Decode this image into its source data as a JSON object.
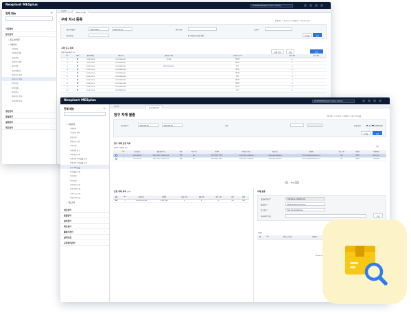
{
  "back": {
    "brand": "Nexplant MESplus",
    "org_select": "IUVCMAN/1Mnsport/ home 1 Factory",
    "sidebar": {
      "title": "전체 메뉴",
      "sections": [
        "기준정보",
        "창고관리"
      ],
      "group": "• 창고관리업무",
      "groups2": [
        "• 자재관리"
      ],
      "items": [
        "구매요청",
        "수입검사 의뢰",
        "자재 전입",
        "자재 입고 접수",
        "자재 이동",
        "부품자재 입고",
        "자재 재고 관리",
        "구매 지시 등록",
        "자재 정보",
        "자재 불출",
        "자재 반납",
        "자재 재고 조회",
        "자재 이력 조회"
      ],
      "sections2": [
        "생산관리",
        "품질관리",
        "설비관리",
        "재고관리"
      ]
    },
    "tabs": [
      "HOME",
      "구매 지시 등록"
    ],
    "title": "구매 지시 등록",
    "breadcrumb": "전체 메뉴 > 창고관리 > 자재관리 > 구매 지시 등록",
    "filters": {
      "order_date_label": "발행 예정일 *",
      "date_from": "2023-09-01",
      "date_to": "2023-10-01",
      "item_label": "품목 번호",
      "supplier_label": "공급처",
      "status_label": "진행 상태",
      "chk_label": "자재 등급 완료 제외",
      "reset": "초기화",
      "search": "조회"
    },
    "list": {
      "title": "구매 요구 목록",
      "count": "전체 25  ▪ 페이지 표시",
      "columns": [
        "No",
        "선택",
        "발행 예정일",
        "품목 번호",
        "구매 요구 번호",
        "구매 요구 수량",
        "발주 수량",
        "입고 처리"
      ],
      "rows": [
        [
          "1",
          "2023-09-08",
          "DLVCNS02001",
          "12346",
          "6",
          "재니퍼"
        ],
        [
          "2",
          "2023-09-09",
          "DLVCNS02002",
          "",
          "6",
          "재니퍼"
        ],
        [
          "3",
          "2023-09-08",
          "DLVCNS02003",
          "PD2303036003",
          "6",
          "김고"
        ],
        [
          "4",
          "2023-09-10",
          "DLVCNS02004",
          "",
          "6",
          "개나리"
        ],
        [
          "5",
          "2023-09-10",
          "DLVCNS02005",
          "",
          "6",
          "아니아"
        ],
        [
          "6",
          "2023-09-11",
          "DLVCNS02006",
          "",
          "6",
          "새다"
        ],
        [
          "7",
          "2023-09-11",
          "DLVCNS02007",
          "",
          "6",
          "재니퍼"
        ],
        [
          "8",
          "2023-09-12",
          "DLVCNS02008",
          "",
          "6",
          "재니퍼"
        ],
        [
          "9",
          "2023-09-13",
          "DLVCNS02009",
          "",
          "6",
          "아니아"
        ],
        [
          "10",
          "2023-09-14",
          "DLVCNS02010",
          "",
          "6",
          "김고"
        ]
      ],
      "buttons": [
        "자재 승인",
        "반납",
        "발주"
      ]
    }
  },
  "front": {
    "brand": "Nexplant MESplus",
    "org_select": "IUVCMAN/1Mnsport/ home 1 Factory",
    "sidebar": {
      "title": "전체 메뉴",
      "group": "• 자재관리",
      "items": [
        "구매요청",
        "수입검사 의뢰",
        "자재 전입",
        "자재 입고 접수",
        "자재 이동",
        "부품자재 입고",
        "자재 재고 관리",
        "부품자재 자재 불출 요청",
        "부품자재 자재 불출 요청",
        "청구 자재 불출",
        "자재 불출 요청",
        "자재 정보",
        "자재 반납",
        "자재 재고 조회",
        "자재 이력 조회",
        "구매 지시 등록",
        "자재 LOT 조회"
      ],
      "group2": "• 재고관리",
      "sections": [
        "생산관리",
        "품질관리",
        "설비관리",
        "재고관리",
        "물류가관리",
        "설비보전",
        "공정관리관리"
      ]
    },
    "tabs": [
      "HOME",
      "청구 자재 불출"
    ],
    "title": "청구 자재 불출",
    "breadcrumb": "전체 메뉴 > 창고관리 > 자재관리 > 청구 자재 불출",
    "filters": {
      "date_label": "요청 일자 *",
      "date_from": "2023-09-01",
      "date_to": "2023-09-01",
      "item_label": "라인",
      "status_label": "요청 상태",
      "status_opts": [
        "요청",
        "진행",
        "완료"
      ],
      "reset": "초기화",
      "search": "조회"
    },
    "req_list": {
      "title": "청구 자재 요청 목록",
      "count": "전체 2  ▪ 페이지 표시",
      "action": "종료",
      "columns": [
        "",
        "No",
        "요청 일자",
        "불출요청 번호",
        "상태",
        "라인 코드",
        "라인명",
        "작업지시 번호",
        "제품 코드",
        "제품명",
        "지시 수량",
        "요청자",
        "자재상태"
      ],
      "rows": [
        [
          "1",
          "2023-09-05",
          "VIRCON11-230905-002",
          "진행",
          "ALL",
          "포장 재고로 이전 1",
          "VIRCON11-2308003",
          "S0000000000S4-6",
          "보조 1000000000S4-6 Ver",
          "100",
          "김연기",
          "PROCESS"
        ],
        [
          "2",
          "2023-09-05",
          "VIRCON11-230905-001",
          "진행",
          "ALL",
          "포장 재고로 이전 1",
          "VIRCON11-2308003",
          "S0000000000S4-6",
          "보조 1000000000S4-6 Ver",
          "100",
          "김연기",
          "CONFIRM"
        ]
      ]
    },
    "pager": {
      "page": "1",
      "size": "Page",
      "per": "10"
    },
    "item_list": {
      "title": "요청 자재 목록",
      "count": "전체 5",
      "columns": [
        "No",
        "자재 코드",
        "자재명",
        "필요 수량",
        "불출수량",
        "요청 수량",
        "단위",
        "상태"
      ],
      "rows": [
        [
          "1",
          "S00000000-1S4",
          "ㅇ 포장 카톤1",
          "4",
          "4",
          "0",
          "EA",
          "진행"
        ]
      ]
    },
    "detail": {
      "title": "자재 불출",
      "fields": [
        {
          "label": "불출요청번호 *",
          "value": "VIRCON11-230905-002"
        },
        {
          "label": "불출창고 *",
          "value": "Material Warehouse #1"
        },
        {
          "label": "입고창고 *",
          "value": "Test line warehouse"
        },
        {
          "label": "자재 LOT 번호",
          "value": ""
        }
      ],
      "search_btn": "조회",
      "sub_title": "전체 0",
      "sub_buttons": [
        "삭제",
        "등록"
      ],
      "sub_columns": [
        "No",
        "자재 LOT 번호",
        "자재코드",
        "자재명",
        "수량"
      ],
      "empty": "No data to display"
    }
  },
  "app_icon": {
    "name": "inventory-search-icon",
    "bg": "#fdf3c9",
    "box": "#f7c815",
    "lens": "#2d7df0"
  }
}
